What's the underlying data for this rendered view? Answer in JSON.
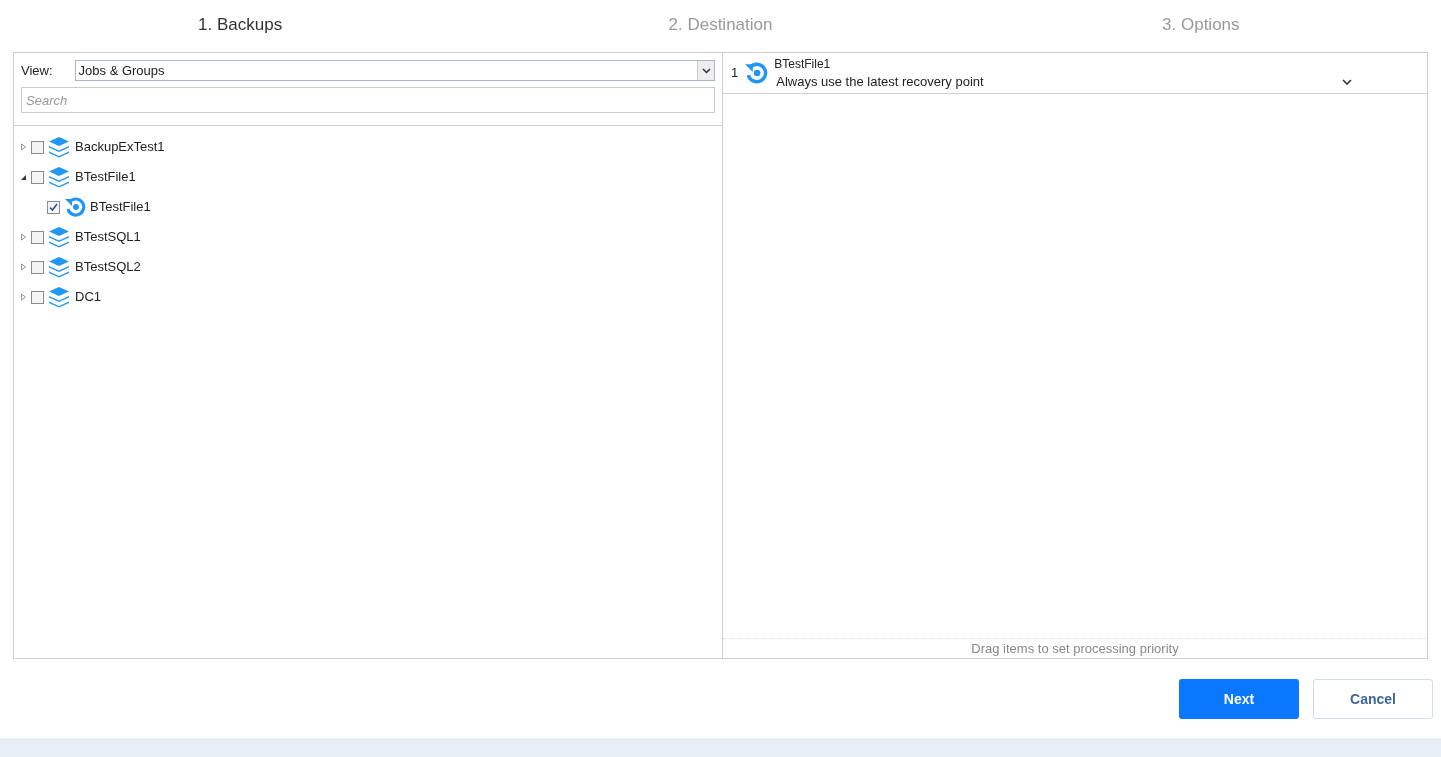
{
  "steps": [
    {
      "label": "1. Backups",
      "selected": true
    },
    {
      "label": "2. Destination",
      "selected": false
    },
    {
      "label": "3. Options",
      "selected": false
    }
  ],
  "left_panel": {
    "view_label": "View:",
    "view_value": "Jobs & Groups",
    "search": {
      "placeholder": "Search"
    },
    "tree": [
      {
        "kind": "group",
        "label": "BackupExTest1",
        "expanded": false,
        "checked": false
      },
      {
        "kind": "group",
        "label": "BTestFile1",
        "expanded": true,
        "checked": false,
        "children": [
          {
            "kind": "job",
            "label": "BTestFile1",
            "checked": true
          }
        ]
      },
      {
        "kind": "group",
        "label": "BTestSQL1",
        "expanded": false,
        "checked": false
      },
      {
        "kind": "group",
        "label": "BTestSQL2",
        "expanded": false,
        "checked": false
      },
      {
        "kind": "group",
        "label": "DC1",
        "expanded": false,
        "checked": false
      }
    ]
  },
  "right_panel": {
    "items": [
      {
        "index": "1",
        "name": "BTestFile1",
        "recovery_point": "Always use the latest recovery point"
      }
    ],
    "footer": "Drag items to set processing priority"
  },
  "buttons": {
    "primary": "Next",
    "secondary": "Cancel"
  }
}
